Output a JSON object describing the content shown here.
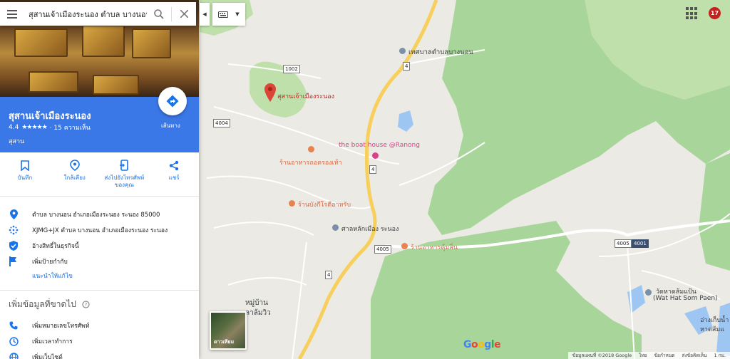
{
  "search": {
    "query": "สุสานเจ้าเมืองระนอง ตำบล บางนอน"
  },
  "place": {
    "name": "สุสานเจ้าเมืองระนอง",
    "rating": "4.4",
    "stars": "★★★★★",
    "reviews": "· 15 ความเห็น",
    "category": "สุสาน",
    "directions_label": "เส้นทาง"
  },
  "actions": [
    {
      "label": "บันทึก",
      "icon": "bookmark-icon"
    },
    {
      "label": "ใกล้เคียง",
      "icon": "nearby-icon"
    },
    {
      "label": "ส่งไปยังโทรศัพท์\nของคุณ",
      "icon": "send-to-phone-icon"
    },
    {
      "label": "แชร์",
      "icon": "share-icon"
    }
  ],
  "info": {
    "address": "ตำบล บางนอน อำเภอเมืองระนอง ระนอง 85000",
    "plus_code": "XJMG+JX ตำบล บางนอน อำเภอเมืองระนอง ระนอง",
    "claim": "อ้างสิทธิ์ในธุรกิจนี้",
    "add_label": "เพิ่มป้ายกำกับ",
    "suggest_edit": "แนะนำให้แก้ไข"
  },
  "missing": {
    "heading": "เพิ่มข้อมูลที่ขาดไป",
    "items": [
      {
        "label": "เพิ่มหมายเลขโทรศัพท์",
        "icon": "phone-icon"
      },
      {
        "label": "เพิ่มเวลาทำการ",
        "icon": "clock-icon"
      },
      {
        "label": "เพิ่มเว็บไซต์",
        "icon": "globe-icon"
      }
    ]
  },
  "map": {
    "labels": {
      "place": "สุสานเจ้าเมืองระนอง",
      "municipality": "เทศบาลตำบลบางนอน",
      "boat_house": "the boat house @Ranong",
      "restaurant1": "ร้านอาหารถอดรองเท้า",
      "restaurant2": "ร้านบังกีโรตีอาหรับ",
      "shrine": "ศาลหลักเมือง ระนอง",
      "restaurant3": "ร้านอาหารคุ้มลิ่น",
      "village_1": "หมู่บ้าน",
      "village_2": "ลาล้มวิว",
      "temple_th": "วัดหาดส้มแป้น",
      "temple_en": "(Wat Hat Som Paen)",
      "beach_1": "อ่างเก็บน้ำ",
      "beach_2": "หาดส้มแ"
    },
    "roads": [
      "1002",
      "4004",
      "4",
      "4",
      "4005",
      "4005",
      "4001",
      "4"
    ],
    "satellite_label": "ดาวเทียม",
    "google": "Google",
    "notifications": "17",
    "footer": [
      "ข้อมูลแผนที่ ©2018 Google",
      "ไทย",
      "ข้อกำหนด",
      "ส่งข้อคิดเห็น",
      "1 กม."
    ]
  }
}
